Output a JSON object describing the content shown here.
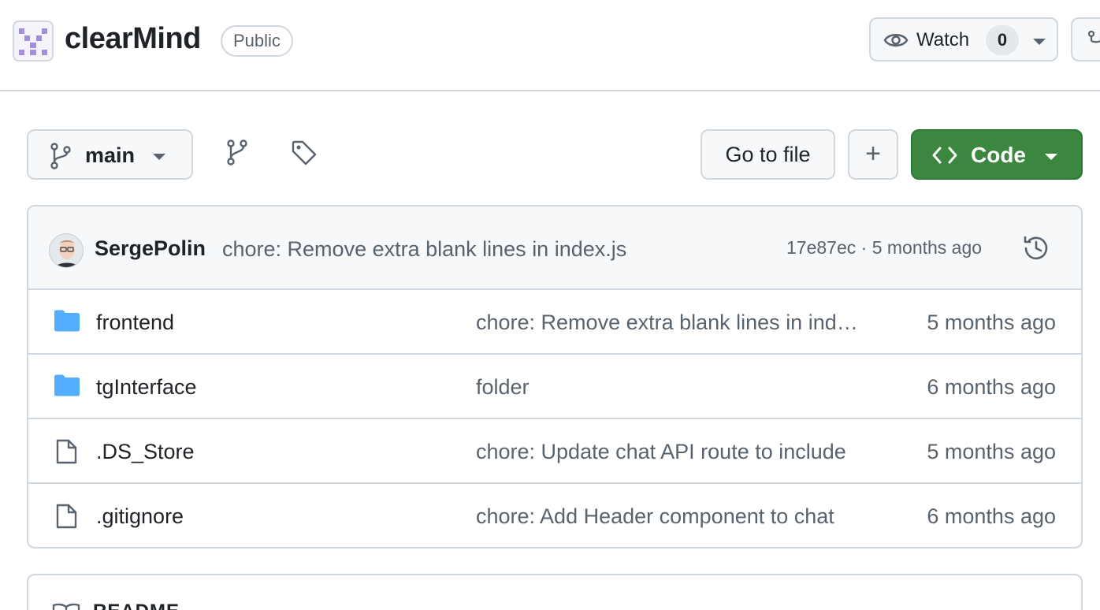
{
  "repo": {
    "name": "clearMind",
    "visibility": "Public"
  },
  "header": {
    "watch_label": "Watch",
    "watch_count": "0"
  },
  "toolbar": {
    "branch": "main",
    "goto_file_label": "Go to file",
    "add_label": "+",
    "code_label": "Code"
  },
  "latest_commit": {
    "author": "SergePolin",
    "message": "chore: Remove extra blank lines in index.js",
    "meta": "17e87ec · 5 months ago"
  },
  "files": [
    {
      "name": "frontend",
      "type": "folder",
      "message": "chore: Remove extra blank lines in index.js",
      "date": "5 months ago"
    },
    {
      "name": "tgInterface",
      "type": "folder",
      "message": "folder",
      "date": "6 months ago"
    },
    {
      "name": ".DS_Store",
      "type": "file",
      "message": "chore: Update chat API route to include",
      "date": "5 months ago"
    },
    {
      "name": ".gitignore",
      "type": "file",
      "message": "chore: Add Header component to chat",
      "date": "6 months ago"
    }
  ],
  "readme": {
    "label": "README"
  },
  "colors": {
    "accent_green": "#3b873f",
    "folder_blue": "#54aeff",
    "border": "#d0d7de",
    "muted_text": "#59636e"
  },
  "icons": {
    "header": [
      "repo-avatar",
      "eye-icon",
      "fork-icon"
    ],
    "toolbar": [
      "branch-icon",
      "branches-icon",
      "tag-icon",
      "code-icon"
    ],
    "commit": [
      "history-icon"
    ],
    "files": [
      "folder-icon",
      "file-icon"
    ],
    "readme": [
      "book-icon"
    ]
  }
}
